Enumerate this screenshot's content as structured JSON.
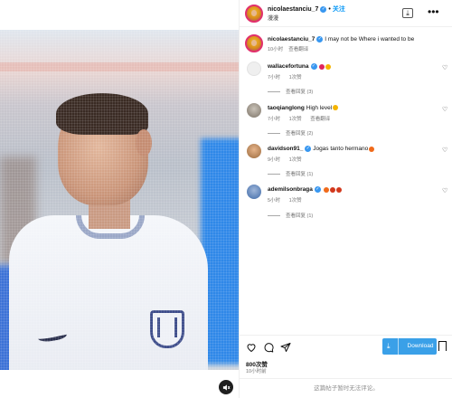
{
  "post": {
    "username": "nicolaestanciu_7",
    "follow_label": "关注",
    "location": "漫漫",
    "verified_mark": "✓"
  },
  "media": {
    "sponsor_text": "融创",
    "mute_icon": "speaker-muted-icon"
  },
  "caption": {
    "username": "nicolaestanciu_7",
    "text": "I may not be Where i wanted to be",
    "time": "10小时",
    "translate": "查看翻译"
  },
  "comments": [
    {
      "username": "wallacefortuna",
      "verified": true,
      "text": "",
      "emojis": [
        "#e0245e",
        "#f5b400"
      ],
      "time": "7小时",
      "likes": "1次赞",
      "translate": "",
      "replies": "查看回复 (3)"
    },
    {
      "username": "taoqianglong",
      "verified": false,
      "text": "High level",
      "emojis": [
        "#f5b400"
      ],
      "time": "7小时",
      "likes": "1次赞",
      "translate": "查看翻译",
      "replies": "查看回复 (2)"
    },
    {
      "username": "davidson91_",
      "verified": true,
      "text": "Jogas tanto hermano",
      "emojis": [
        "#f06a1a"
      ],
      "time": "9小时",
      "likes": "1次赞",
      "translate": "",
      "replies": "查看回复 (1)"
    },
    {
      "username": "ademilsonbraga",
      "verified": true,
      "text": "",
      "emojis": [
        "#f06a1a",
        "#d2381c",
        "#d2381c"
      ],
      "time": "5小时",
      "likes": "1次赞",
      "translate": "",
      "replies": "查看回复 (1)"
    }
  ],
  "actions": {
    "download_label": "Download",
    "likes": "800次赞",
    "time": "10小时前",
    "comment_placeholder": "这篇帖子暂时无法评论。"
  },
  "colors": {
    "accent": "#0095f6",
    "download_button": "#3aa0e8",
    "verified": "#3897f0"
  }
}
